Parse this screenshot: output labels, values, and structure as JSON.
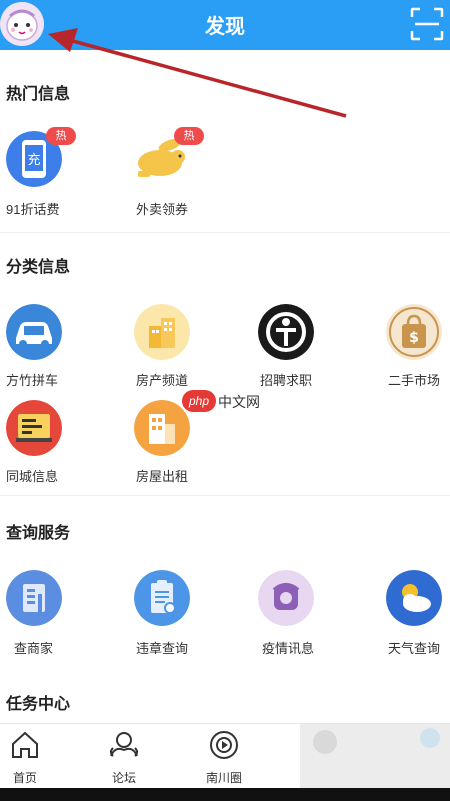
{
  "header": {
    "title": "发现"
  },
  "sections": {
    "hot": {
      "title": "热门信息",
      "items": [
        {
          "label": "91折话费",
          "badge": "热",
          "icon_glyph": "充"
        },
        {
          "label": "外卖领券",
          "badge": "热"
        }
      ]
    },
    "category": {
      "title": "分类信息",
      "items": [
        {
          "label": "方竹拼车"
        },
        {
          "label": "房产频道"
        },
        {
          "label": "招聘求职"
        },
        {
          "label": "二手市场",
          "icon_glyph": "$"
        },
        {
          "label": "同城信息"
        },
        {
          "label": "房屋出租"
        }
      ]
    },
    "query": {
      "title": "查询服务",
      "items": [
        {
          "label": "查商家"
        },
        {
          "label": "违章查询"
        },
        {
          "label": "疫情讯息"
        },
        {
          "label": "天气查询"
        }
      ]
    },
    "task": {
      "title": "任务中心"
    }
  },
  "tabbar": {
    "items": [
      {
        "label": "首页",
        "icon": "home-icon"
      },
      {
        "label": "论坛",
        "icon": "forum-icon"
      },
      {
        "label": "南川圈",
        "icon": "circle-icon"
      }
    ]
  },
  "watermark": {
    "php": "php",
    "text": "中文网"
  },
  "colors": {
    "header": "#2a9df4",
    "badge": "#f04b4b",
    "arrow": "#b8262b"
  }
}
